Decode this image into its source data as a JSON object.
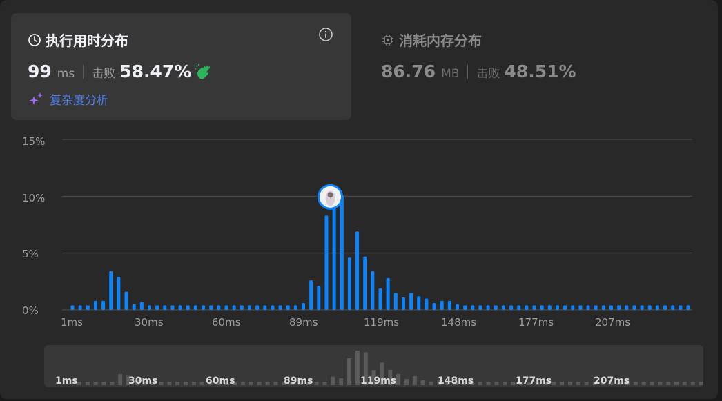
{
  "runtime": {
    "title": "执行用时分布",
    "value": "99",
    "unit": "ms",
    "beat_label": "击败",
    "beat_pct": "58.47%",
    "complexity_link": "复杂度分析"
  },
  "memory": {
    "title": "消耗内存分布",
    "value": "86.76",
    "unit": "MB",
    "beat_label": "击败",
    "beat_pct": "48.51%"
  },
  "icons": {
    "clock": "clock-icon",
    "info": "info-icon",
    "clap": "clap-icon",
    "sparkle": "sparkle-icon",
    "chip": "chip-icon",
    "avatar": "user-avatar"
  },
  "colors": {
    "bar": "#0a84ff",
    "nav_bar": "#5a5a5a",
    "clap": "#2db55d",
    "link": "#4e7ee6",
    "sparkle": "#a26bfa"
  },
  "chart_data": {
    "type": "bar",
    "y_ticks": [
      "15%",
      "10%",
      "5%",
      "0%"
    ],
    "ylim": [
      0,
      15
    ],
    "x_tick_labels": [
      "1ms",
      "30ms",
      "60ms",
      "89ms",
      "119ms",
      "148ms",
      "177ms",
      "207ms"
    ],
    "highlight_index": 33,
    "values": [
      0.4,
      0.4,
      0.4,
      0.8,
      0.8,
      3.4,
      2.9,
      1.6,
      0.5,
      0.7,
      0.4,
      0.4,
      0.4,
      0.4,
      0.4,
      0.4,
      0.4,
      0.4,
      0.4,
      0.4,
      0.4,
      0.4,
      0.4,
      0.4,
      0.4,
      0.4,
      0.4,
      0.4,
      0.4,
      0.4,
      0.6,
      2.6,
      2.1,
      8.3,
      10.6,
      10.1,
      4.6,
      6.9,
      4.7,
      3.4,
      1.9,
      2.8,
      1.5,
      1.1,
      1.5,
      1.2,
      1.0,
      0.6,
      0.8,
      0.8,
      0.5,
      0.4,
      0.4,
      0.4,
      0.4,
      0.4,
      0.4,
      0.4,
      0.4,
      0.4,
      0.4,
      0.4,
      0.4,
      0.4,
      0.4,
      0.4,
      0.4,
      0.4,
      0.4,
      0.4,
      0.4,
      0.4,
      0.4,
      0.4,
      0.4,
      0.4,
      0.4,
      0.4,
      0.4,
      0.4,
      0.4
    ]
  },
  "navigator": {
    "labels": [
      "1ms",
      "30ms",
      "60ms",
      "89ms",
      "119ms",
      "148ms",
      "177ms",
      "207ms"
    ]
  }
}
